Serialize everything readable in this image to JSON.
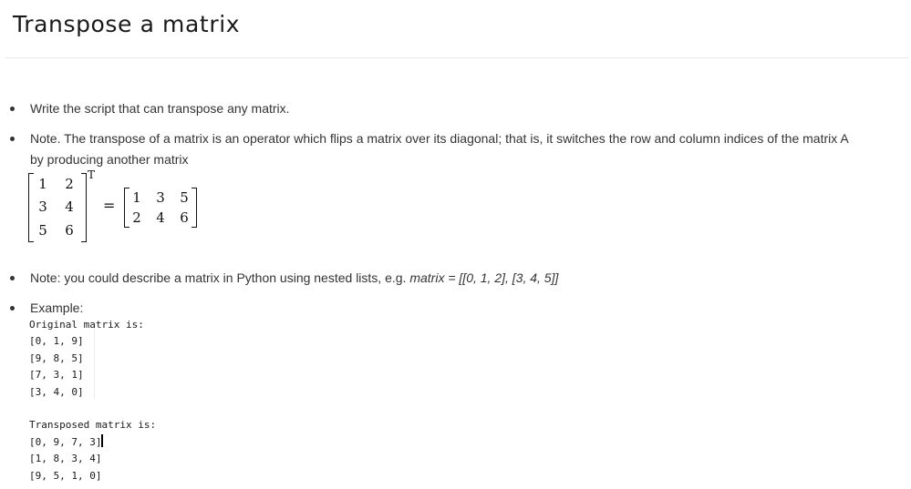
{
  "page": {
    "title": "Transpose a matrix"
  },
  "bullets": [
    {
      "id": "write-script",
      "text": "Write the script that can transpose any matrix."
    },
    {
      "id": "note-transpose",
      "line1": "Note. The transpose of a matrix is an operator which flips a matrix over its diagonal; that is, it switches the row and column indices of the matrix A",
      "line2": "by producing another matrix"
    },
    {
      "id": "note-python",
      "prefix": "Note: you could describe a matrix in Python using nested lists, e.g. ",
      "code": "matrix = [[0, 1, 2], [3, 4, 5]]"
    },
    {
      "id": "example",
      "text": "Example:"
    }
  ],
  "equation": {
    "left_matrix": [
      [
        "1",
        "2"
      ],
      [
        "3",
        "4"
      ],
      [
        "5",
        "6"
      ]
    ],
    "transpose_symbol": "T",
    "equals": "=",
    "right_matrix": [
      [
        "1",
        "3",
        "5"
      ],
      [
        "2",
        "4",
        "6"
      ]
    ]
  },
  "example_output": {
    "original_header": "Original matrix is:",
    "original_rows": [
      "[0, 1, 9]",
      "[9, 8, 5]",
      "[7, 3, 1]",
      "[3, 4, 0]"
    ],
    "transposed_header": "Transposed matrix is:",
    "transposed_rows": [
      "[0, 9, 7, 3]",
      "[1, 8, 3, 4]",
      "[9, 5, 1, 0]"
    ]
  }
}
